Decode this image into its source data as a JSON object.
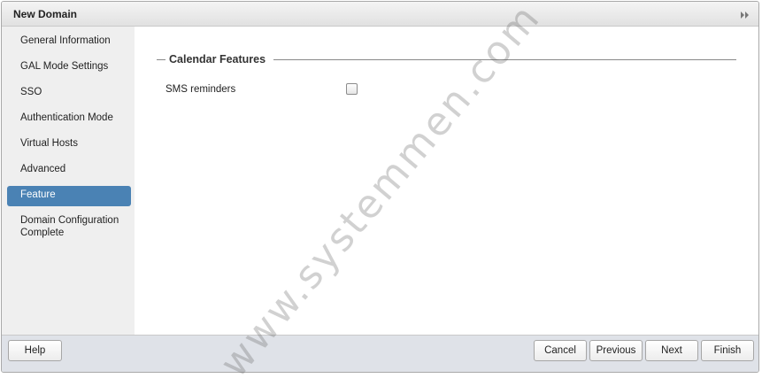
{
  "dialog": {
    "title": "New Domain",
    "collapse_icon": "double-chevron-right-icon"
  },
  "sidebar": {
    "items": [
      {
        "label": "General Information",
        "selected": false
      },
      {
        "label": "GAL Mode Settings",
        "selected": false
      },
      {
        "label": "SSO",
        "selected": false
      },
      {
        "label": "Authentication Mode",
        "selected": false
      },
      {
        "label": "Virtual Hosts",
        "selected": false
      },
      {
        "label": "Advanced",
        "selected": false
      },
      {
        "label": "Feature",
        "selected": true
      },
      {
        "label": "Domain Configuration Complete",
        "selected": false
      }
    ],
    "selected_color": "#4a82b4"
  },
  "content": {
    "section_title": "Calendar Features",
    "fields": [
      {
        "label": "SMS reminders",
        "checked": false
      }
    ]
  },
  "footer": {
    "help_label": "Help",
    "cancel_label": "Cancel",
    "previous_label": "Previous",
    "next_label": "Next",
    "finish_label": "Finish"
  },
  "watermark": "www.systemmen.com"
}
